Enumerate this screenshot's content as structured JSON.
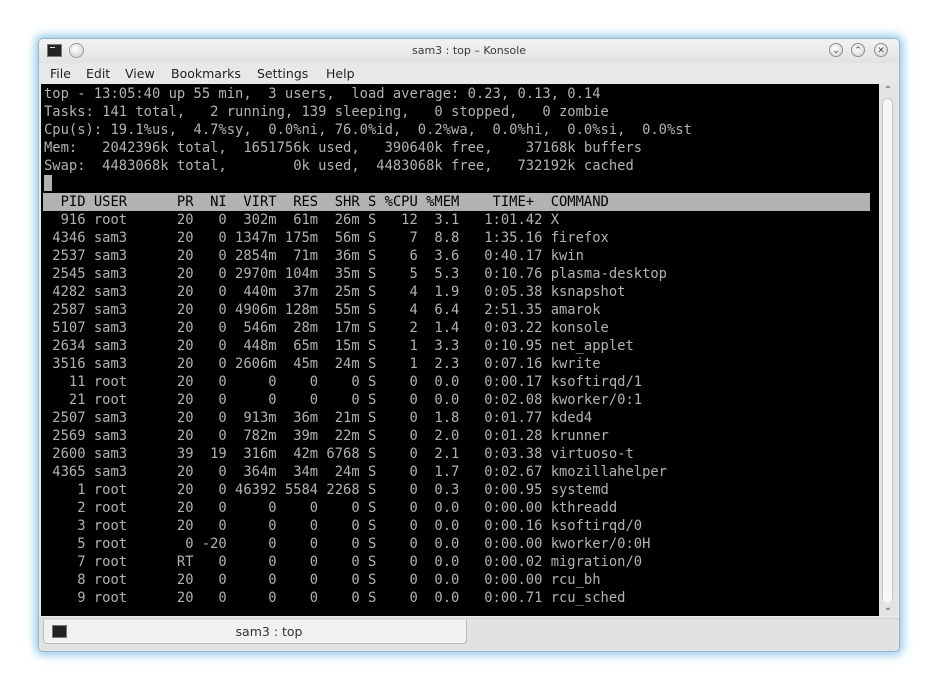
{
  "window": {
    "title": "sam3 : top – Konsole"
  },
  "menu": [
    "File",
    "Edit",
    "View",
    "Bookmarks",
    "Settings",
    "Help"
  ],
  "terminal": {
    "summary": [
      "top - 13:05:40 up 55 min,  3 users,  load average: 0.23, 0.13, 0.14",
      "Tasks: 141 total,   2 running, 139 sleeping,   0 stopped,   0 zombie",
      "Cpu(s): 19.1%us,  4.7%sy,  0.0%ni, 76.0%id,  0.2%wa,  0.0%hi,  0.0%si,  0.0%st",
      "Mem:   2042396k total,  1651756k used,   390640k free,    37168k buffers",
      "Swap:  4483068k total,        0k used,  4483068k free,   732192k cached"
    ],
    "header": "  PID USER      PR  NI  VIRT  RES  SHR S %CPU %MEM    TIME+  COMMAND",
    "processes": [
      "  916 root      20   0  302m  61m  26m S   12  3.1   1:01.42 X",
      " 4346 sam3      20   0 1347m 175m  56m S    7  8.8   1:35.16 firefox",
      " 2537 sam3      20   0 2854m  71m  36m S    6  3.6   0:40.17 kwin",
      " 2545 sam3      20   0 2970m 104m  35m S    5  5.3   0:10.76 plasma-desktop",
      " 4282 sam3      20   0  440m  37m  25m S    4  1.9   0:05.38 ksnapshot",
      " 2587 sam3      20   0 4906m 128m  55m S    4  6.4   2:51.35 amarok",
      " 5107 sam3      20   0  546m  28m  17m S    2  1.4   0:03.22 konsole",
      " 2634 sam3      20   0  448m  65m  15m S    1  3.3   0:10.95 net_applet",
      " 3516 sam3      20   0 2606m  45m  24m S    1  2.3   0:07.16 kwrite",
      "   11 root      20   0     0    0    0 S    0  0.0   0:00.17 ksoftirqd/1",
      "   21 root      20   0     0    0    0 S    0  0.0   0:02.08 kworker/0:1",
      " 2507 sam3      20   0  913m  36m  21m S    0  1.8   0:01.77 kded4",
      " 2569 sam3      20   0  782m  39m  22m S    0  2.0   0:01.28 krunner",
      " 2600 sam3      39  19  316m  42m 6768 S    0  2.1   0:03.38 virtuoso-t",
      " 4365 sam3      20   0  364m  34m  24m S    0  1.7   0:02.67 kmozillahelper",
      "    1 root      20   0 46392 5584 2268 S    0  0.3   0:00.95 systemd",
      "    2 root      20   0     0    0    0 S    0  0.0   0:00.00 kthreadd",
      "    3 root      20   0     0    0    0 S    0  0.0   0:00.16 ksoftirqd/0",
      "    5 root       0 -20     0    0    0 S    0  0.0   0:00.00 kworker/0:0H",
      "    7 root      RT   0     0    0    0 S    0  0.0   0:00.02 migration/0",
      "    8 root      20   0     0    0    0 S    0  0.0   0:00.00 rcu_bh",
      "    9 root      20   0     0    0    0 S    0  0.0   0:00.71 rcu_sched"
    ]
  },
  "tab": {
    "label": "sam3 : top"
  },
  "icons": {
    "app": "terminal-icon",
    "pin": "pin-icon",
    "minimize": "chevron-down-icon",
    "maximize": "chevron-up-icon",
    "close": "close-icon",
    "scroll_up": "arrow-up-icon",
    "scroll_down": "arrow-down-icon"
  }
}
